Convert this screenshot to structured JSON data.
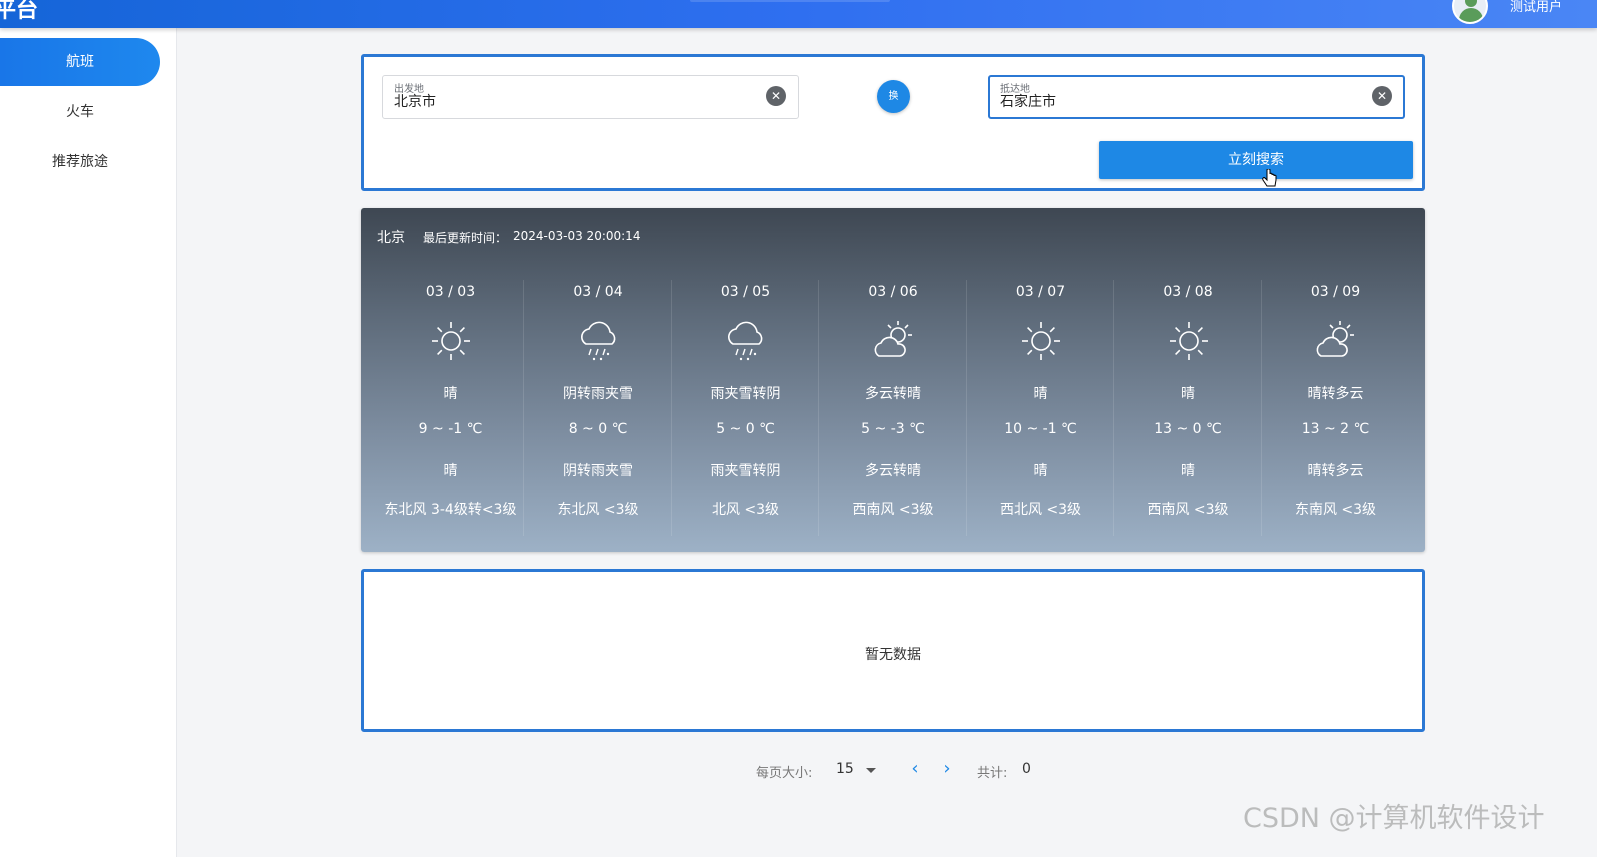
{
  "header": {
    "brand": "平台",
    "username": "测试用户"
  },
  "sidebar": {
    "items": [
      {
        "label": "航班",
        "active": true
      },
      {
        "label": "火车",
        "active": false
      },
      {
        "label": "推荐旅途",
        "active": false
      }
    ]
  },
  "search": {
    "from_label": "出发地",
    "from_value": "北京市",
    "to_label": "抵达地",
    "to_value": "石家庄市",
    "clear_icon": "clear-icon",
    "swap_label": "换",
    "submit_label": "立刻搜索"
  },
  "weather": {
    "city": "北京",
    "update_label": "最后更新时间：",
    "update_time": "2024-03-03 20:00:14",
    "days": [
      {
        "date": "03 / 03",
        "icon": "sunny-icon",
        "cond": "晴",
        "temp": "9 ~ -1 ℃",
        "cond2": "晴",
        "wind": "东北风 3-4级转<3级"
      },
      {
        "date": "03 / 04",
        "icon": "rain-snow-icon",
        "cond": "阴转雨夹雪",
        "temp": "8 ~ 0 ℃",
        "cond2": "阴转雨夹雪",
        "wind": "东北风 <3级"
      },
      {
        "date": "03 / 05",
        "icon": "rain-snow-icon",
        "cond": "雨夹雪转阴",
        "temp": "5 ~ 0 ℃",
        "cond2": "雨夹雪转阴",
        "wind": "北风 <3级"
      },
      {
        "date": "03 / 06",
        "icon": "partly-cloudy-icon",
        "cond": "多云转晴",
        "temp": "5 ~ -3 ℃",
        "cond2": "多云转晴",
        "wind": "西南风 <3级"
      },
      {
        "date": "03 / 07",
        "icon": "sunny-icon",
        "cond": "晴",
        "temp": "10 ~ -1 ℃",
        "cond2": "晴",
        "wind": "西北风 <3级"
      },
      {
        "date": "03 / 08",
        "icon": "sunny-icon",
        "cond": "晴",
        "temp": "13 ~ 0 ℃",
        "cond2": "晴",
        "wind": "西南风 <3级"
      },
      {
        "date": "03 / 09",
        "icon": "partly-cloudy-icon",
        "cond": "晴转多云",
        "temp": "13 ~ 2 ℃",
        "cond2": "晴转多云",
        "wind": "东南风 <3级"
      }
    ]
  },
  "results": {
    "empty_text": "暂无数据"
  },
  "pagination": {
    "page_size_label": "每页大小:",
    "page_size": "15",
    "total_label": "共计:",
    "total": "0"
  },
  "watermark": "CSDN @计算机软件设计",
  "colors": {
    "accent": "#1e88e5",
    "border": "#2b78d4",
    "header": "#1565d8"
  }
}
